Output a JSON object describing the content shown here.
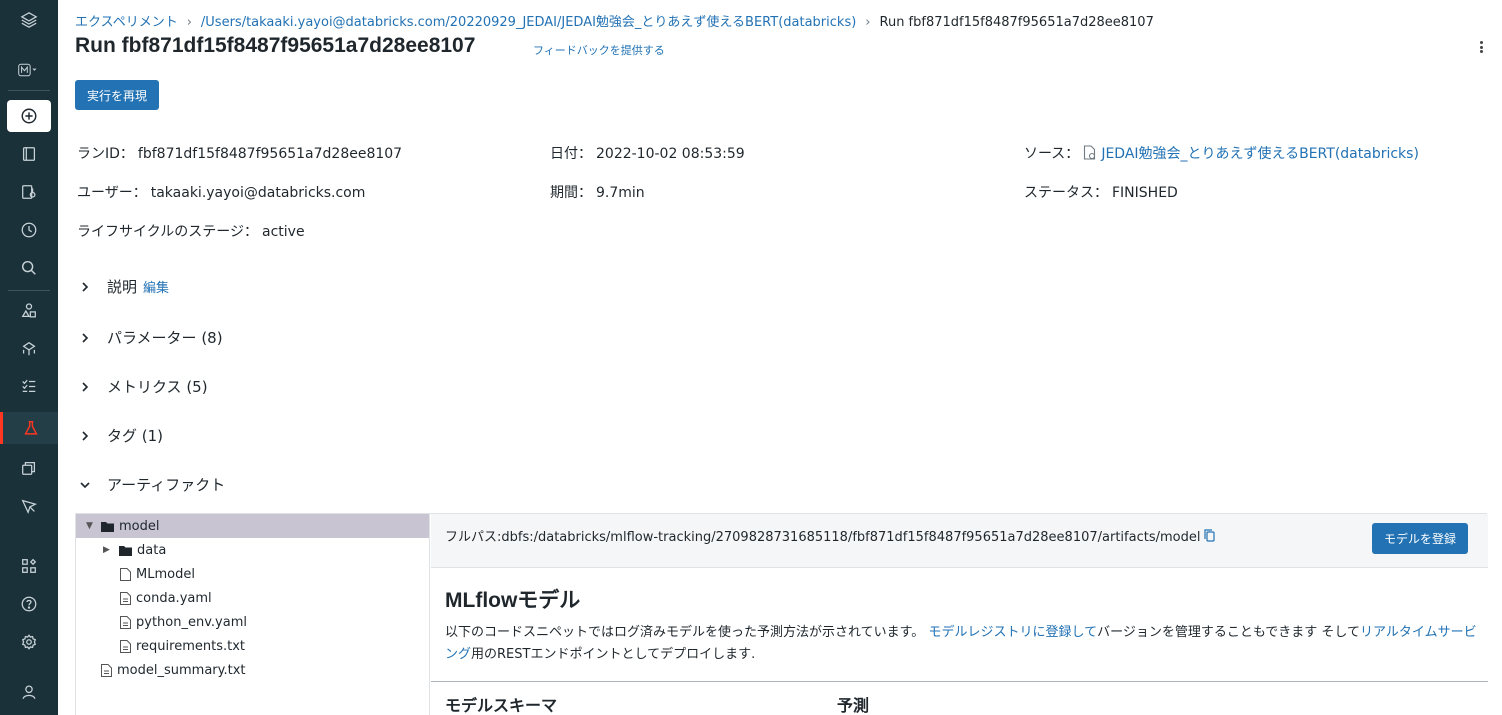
{
  "breadcrumb": {
    "experiments": "エクスペリメント",
    "notebook_path": "/Users/takaaki.yayoi@databricks.com/20220929_JEDAI/JEDAI勉強会_とりあえず使えるBERT(databricks)",
    "current": "Run fbf871df15f8487f95651a7d28ee8107"
  },
  "page": {
    "title": "Run fbf871df15f8487f95651a7d28ee8107",
    "feedback": "フィードバックを提供する",
    "rerun_button": "実行を再現"
  },
  "meta": {
    "run_id_label": "ランID：",
    "run_id": "fbf871df15f8487f95651a7d28ee8107",
    "date_label": "日付：",
    "date": "2022-10-02 08:53:59",
    "source_label": "ソース：",
    "source": "JEDAI勉強会_とりあえず使えるBERT(databricks)",
    "user_label": "ユーザー：",
    "user": "takaaki.yayoi@databricks.com",
    "duration_label": "期間：",
    "duration": "9.7min",
    "status_label": "ステータス：",
    "status": "FINISHED",
    "lifecycle_label": "ライフサイクルのステージ：",
    "lifecycle": "active"
  },
  "sections": {
    "description": "説明",
    "edit": "編集",
    "parameters": "パラメーター (8)",
    "metrics": "メトリクス (5)",
    "tags": "タグ (1)",
    "artifacts": "アーティファクト"
  },
  "tree": {
    "model": "model",
    "data": "data",
    "mlmodel": "MLmodel",
    "conda": "conda.yaml",
    "python_env": "python_env.yaml",
    "requirements": "requirements.txt",
    "model_summary": "model_summary.txt"
  },
  "detail": {
    "fullpath": "フルパス:dbfs:/databricks/mlflow-tracking/2709828731685118/fbf871df15f8487f95651a7d28ee8107/artifacts/model",
    "register_button": "モデルを登録",
    "title": "MLflowモデル",
    "desc_1": "以下のコードスニペットではログ済みモデルを使った予測方法が示されています。 ",
    "desc_link1": "モデルレジストリに登録して",
    "desc_2": "バージョンを管理することもできます そして",
    "desc_link2": "リアルタイムサービング",
    "desc_3": "用のRESTエンドポイントとしてデプロイします.",
    "schema_heading": "モデルスキーマ",
    "predict_heading": "予測"
  },
  "colors": {
    "sidebar": "#1b3139",
    "accent": "#2272b4",
    "active_marker": "#ff3621"
  }
}
